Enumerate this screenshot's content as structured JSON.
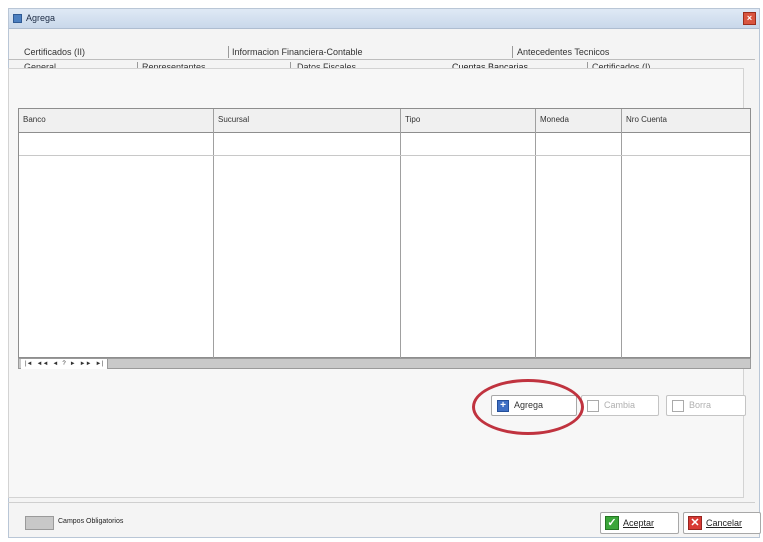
{
  "window": {
    "title": "Agrega",
    "close": "×"
  },
  "tabs_row1": [
    {
      "label": "Certificados (II)"
    },
    {
      "label": "Informacion Financiera-Contable"
    },
    {
      "label": "Antecedentes Tecnicos"
    }
  ],
  "tabs_row2": [
    {
      "label": "General"
    },
    {
      "label": "Representantes"
    },
    {
      "label": "Datos Fiscales"
    },
    {
      "label": "Cuentas Bancarias",
      "active": true
    },
    {
      "label": "Certificados (I)"
    }
  ],
  "grid": {
    "columns": [
      "Banco",
      "Sucursal",
      "Tipo",
      "Moneda",
      "Nro Cuenta"
    ],
    "rows": []
  },
  "navigator": {
    "buttons": [
      "|◄",
      "◄◄",
      "◄",
      "?",
      "►",
      "►►",
      "►|"
    ]
  },
  "actions": {
    "add_label": "Agrega",
    "add_icon": "plus-icon",
    "change_label": "Cambia",
    "delete_label": "Borra"
  },
  "legend": {
    "label": "Campos Obligatorios"
  },
  "footer": {
    "accept_label": "Aceptar",
    "cancel_label": "Cancelar",
    "accept_icon": "check-icon",
    "cancel_icon": "x-icon"
  },
  "colors": {
    "highlight": "#c0333f",
    "accept": "#3ba63a",
    "cancel": "#d83a34",
    "add": "#3f6fc4"
  }
}
